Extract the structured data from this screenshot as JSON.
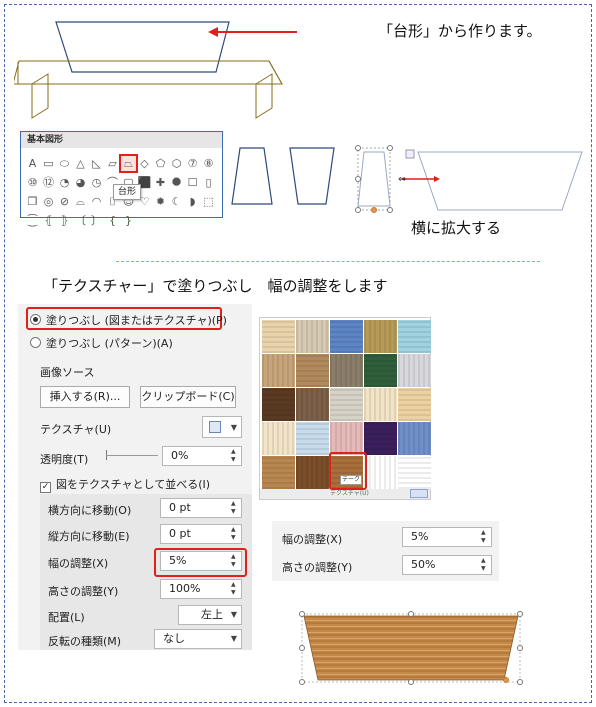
{
  "captions": {
    "make_trapezoid": "「台形」から作ります。",
    "stretch_horizontal": "横に拡大する",
    "texture_width": "「テクスチャー」で塗りつぶし　幅の調整をします"
  },
  "shapes_gallery": {
    "title": "基本図形",
    "tooltip": "台形",
    "icons": [
      "A",
      "▭",
      "⬭",
      "△",
      "◺",
      "▱",
      "⏢",
      "◇",
      "⬠",
      "⬡",
      "⑦",
      "⑧",
      "⑩",
      "⑫",
      "◔",
      "◕",
      "◷",
      "⌒",
      "▢",
      "⬛",
      "✚",
      "⯃",
      "☐",
      "▯",
      "❒",
      "◎",
      "⊘",
      "⌓",
      "◠",
      "⌷",
      "☺",
      "♡",
      "✹",
      "☾",
      "◗",
      "⬚",
      "⁐",
      "⦃",
      "⦄",
      "〔",
      "〕",
      "{",
      "}"
    ]
  },
  "fill_panel": {
    "fill_texture": "塗りつぶし (図またはテクスチャ)(P)",
    "fill_pattern": "塗りつぶし (パターン)(A)",
    "image_source": "画像ソース",
    "insert_button": "挿入する(R)...",
    "clipboard_button": "クリップボード(C)",
    "texture_label": "テクスチャ(U)",
    "transparency_label": "透明度(T)",
    "transparency_value": "0%",
    "tile_checkbox": "図をテクスチャとして並べる(I)",
    "offset_x_label": "横方向に移動(O)",
    "offset_x_value": "0 pt",
    "offset_y_label": "縦方向に移動(E)",
    "offset_y_value": "0 pt",
    "scale_x_label": "幅の調整(X)",
    "scale_x_value": "5%",
    "scale_y_label": "高さの調整(Y)",
    "scale_y_value": "100%",
    "alignment_label": "配置(L)",
    "alignment_value": "左上",
    "mirror_label": "反転の種類(M)",
    "mirror_value": "なし"
  },
  "texture_palette": {
    "footer": "テクスチャ(U)",
    "selected_tip": "テーク",
    "swatch_colors": [
      "#e8d3ab",
      "#d6c9b2",
      "#5d84c4",
      "#b79a58",
      "#9fd3e0",
      "#c8a47a",
      "#b08a5c",
      "#8a7e6a",
      "#2f5e3a",
      "#d8d8dc",
      "#5a3a22",
      "#7c6048",
      "#d7d2c8",
      "#f1e3c6",
      "#ecd2a0",
      "#f3e4c8",
      "#c6dbec",
      "#e6b9b9",
      "#3a1f5c",
      "#6f8fc8",
      "#b8874f",
      "#7b4e2a",
      "#a86f3a",
      "#ffffff",
      "#ffffff"
    ]
  },
  "scale_panel": {
    "scale_x_label": "幅の調整(X)",
    "scale_x_value": "5%",
    "scale_y_label": "高さの調整(Y)",
    "scale_y_value": "50%"
  },
  "colors": {
    "accent_red": "#e0201a",
    "outline_blue": "#2e4a7d",
    "table_olive": "#8a6d1a",
    "wood": "#c48a4a"
  }
}
